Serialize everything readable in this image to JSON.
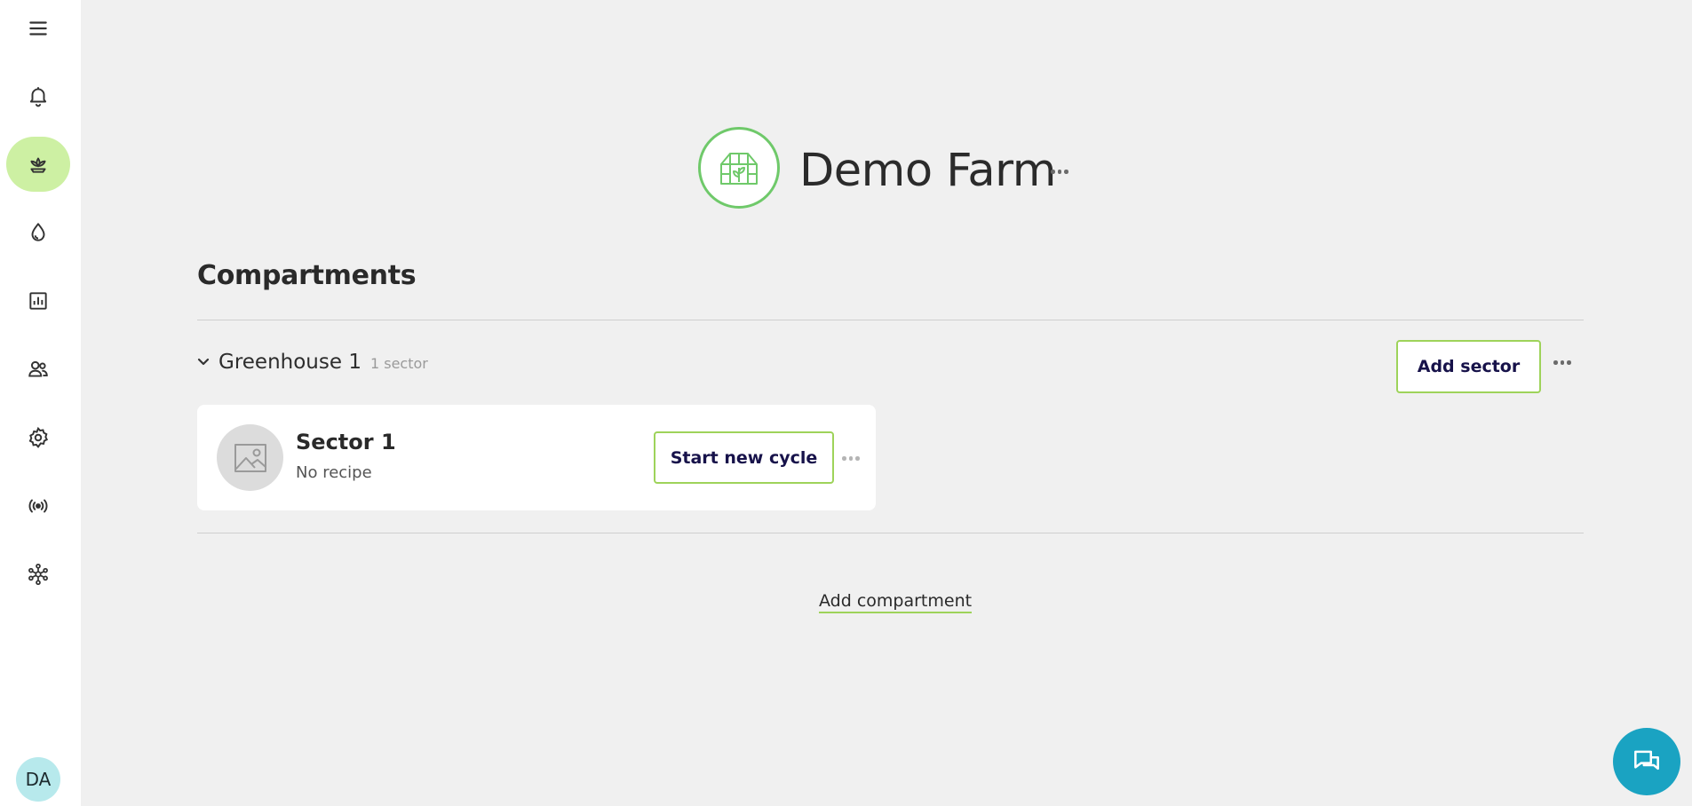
{
  "sidebar": {
    "items": [
      {
        "icon": "menu-icon"
      },
      {
        "icon": "bell-icon"
      },
      {
        "icon": "plant-icon",
        "active": true
      },
      {
        "icon": "water-drop-icon"
      },
      {
        "icon": "chart-icon"
      },
      {
        "icon": "users-icon"
      },
      {
        "icon": "gear-icon"
      },
      {
        "icon": "broadcast-icon"
      },
      {
        "icon": "network-icon"
      }
    ],
    "avatar": "DA",
    "active_color": "#cdf0a3"
  },
  "header": {
    "farm_name": "Demo Farm",
    "logo_icon": "greenhouse-icon",
    "accent_color": "#6fc96a"
  },
  "main": {
    "section_title": "Compartments",
    "compartments": [
      {
        "name": "Greenhouse 1",
        "count": "1 sector",
        "add_sector_label": "Add sector",
        "sectors": [
          {
            "name": "Sector 1",
            "recipe": "No recipe",
            "action_label": "Start new cycle",
            "thumb_icon": "image-placeholder-icon"
          }
        ]
      }
    ],
    "add_compartment_label": "Add compartment"
  },
  "chat": {
    "icon": "chat-icon",
    "color": "#1aa3c2"
  }
}
